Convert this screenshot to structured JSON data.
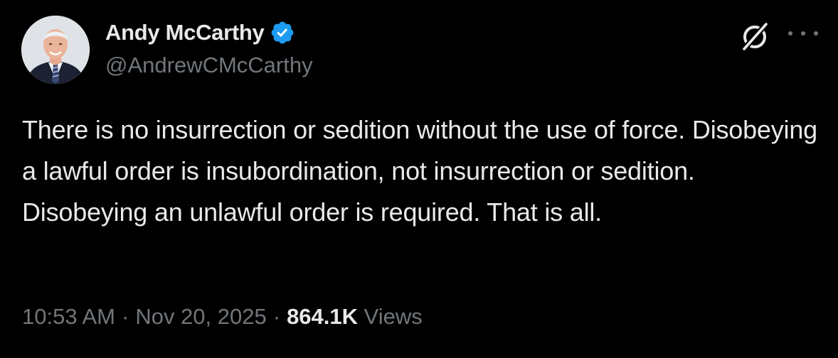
{
  "author": {
    "display_name": "Andy McCarthy",
    "handle": "@AndrewCMcCarthy",
    "verified": true,
    "verified_color": "#1d9bf0",
    "avatar_icon": "profile-photo"
  },
  "actions": {
    "grok_icon": "grok-icon",
    "more_icon": "more-icon"
  },
  "tweet": {
    "text": "There is no insurrection or sedition without the use of force. Disobeying a lawful order is insubordination, not insurrection or sedition. Disobeying an unlawful order is required. That is all."
  },
  "meta": {
    "time": "10:53 AM",
    "separator": "·",
    "date": "Nov 20, 2025",
    "views_count": "864.1K",
    "views_label": "Views"
  },
  "colors": {
    "background": "#000000",
    "primary_text": "#e7e9ea",
    "secondary_text": "#71767b"
  }
}
